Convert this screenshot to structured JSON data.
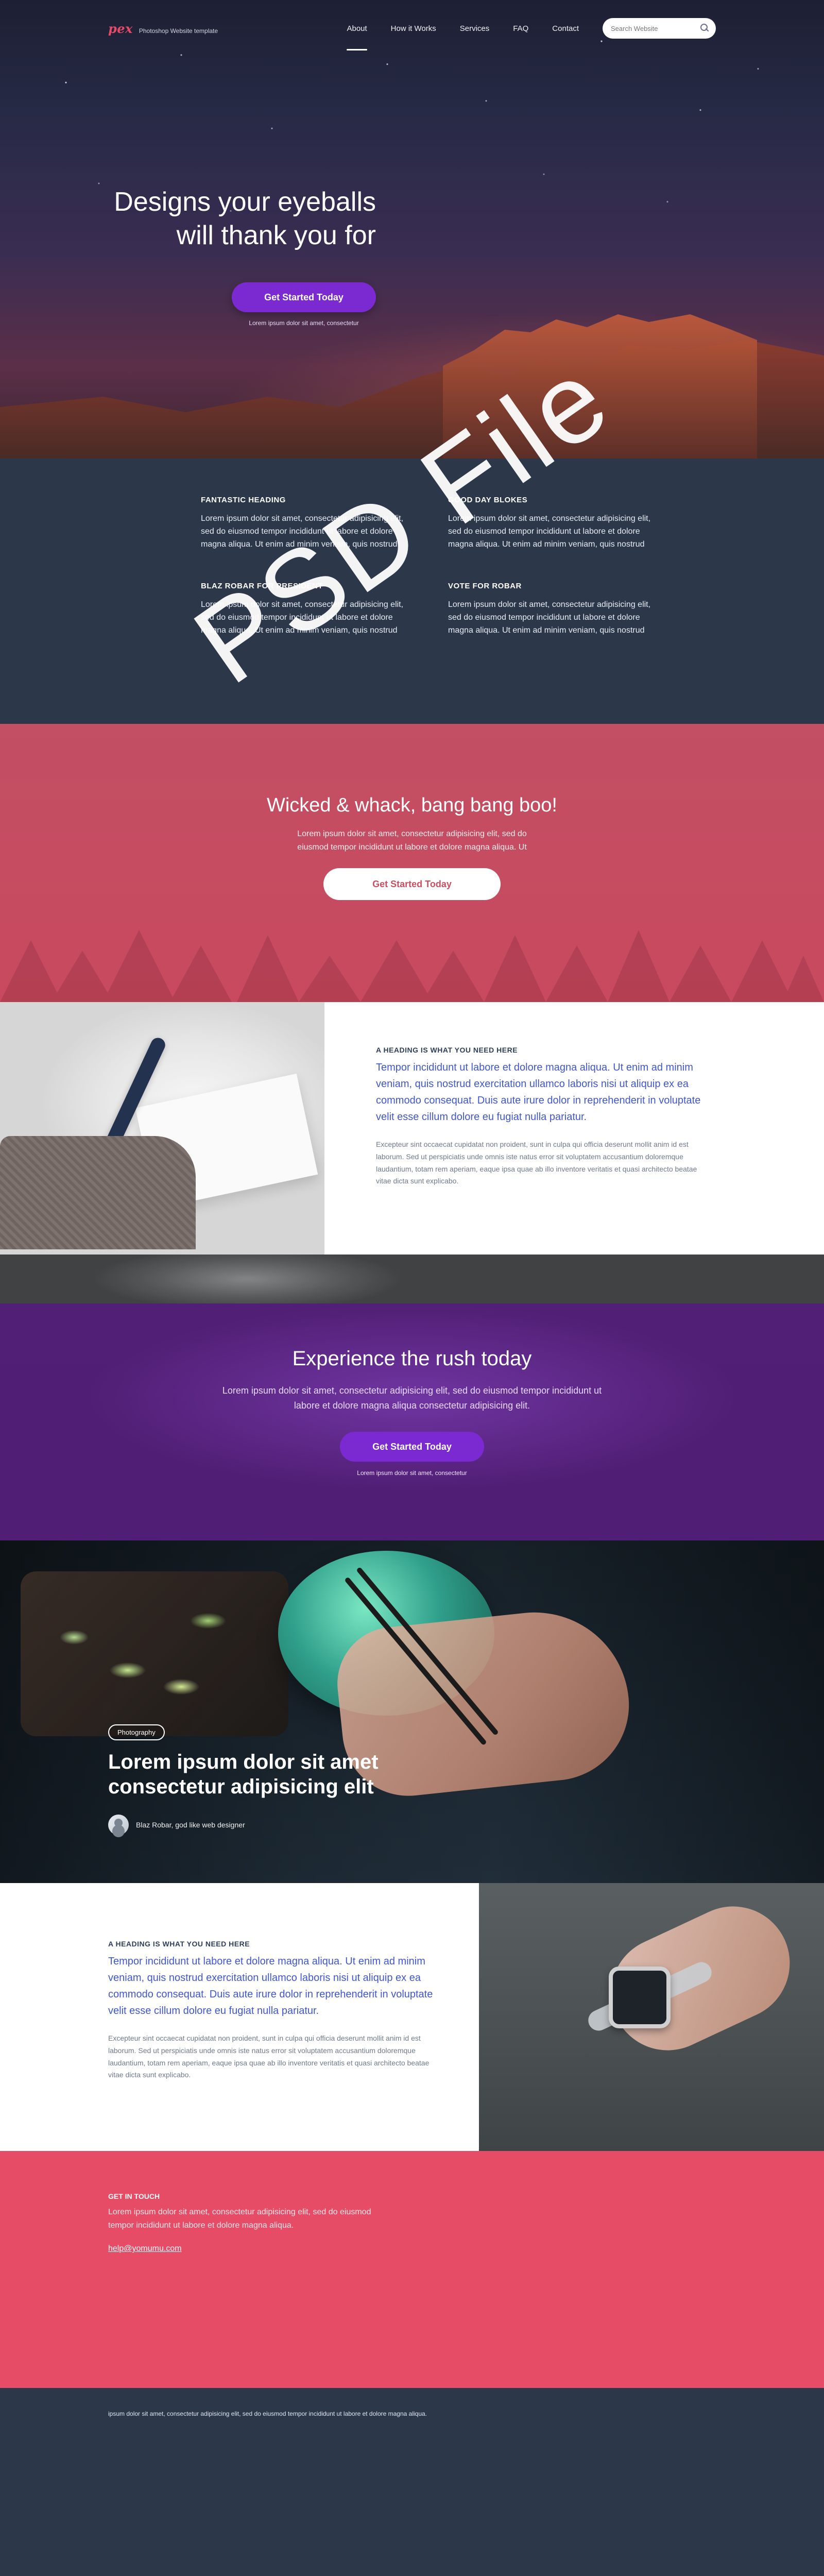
{
  "header": {
    "brand_logo": "pex",
    "brand_tagline": "Photoshop Website template",
    "nav": [
      {
        "label": "About",
        "active": true
      },
      {
        "label": "How it Works"
      },
      {
        "label": "Services"
      },
      {
        "label": "FAQ"
      },
      {
        "label": "Contact"
      }
    ],
    "search_placeholder": "Search Website"
  },
  "hero": {
    "title_line1": "Designs your eyeballs",
    "title_line2": "will thank you for",
    "cta_label": "Get Started Today",
    "subtext": "Lorem ipsum dolor sit amet, consectetur"
  },
  "watermark": "PSD File",
  "features": [
    {
      "title": "FANTASTIC HEADING",
      "text": "Lorem ipsum dolor sit amet, consectetur adipisicing elit, sed do eiusmod tempor incididunt ut labore et dolore magna aliqua. Ut enim ad minim veniam, quis nostrud"
    },
    {
      "title": "GOOD DAY BLOKES",
      "text": "Lorem ipsum dolor sit amet, consectetur adipisicing elit, sed do eiusmod tempor incididunt ut labore et dolore magna aliqua. Ut enim ad minim veniam, quis nostrud"
    },
    {
      "title": "BLAZ ROBAR FOR PRESIDENT",
      "text": "Lorem ipsum dolor sit amet, consectetur adipisicing elit, sed do eiusmod tempor incididunt ut labore et dolore magna aliqua. Ut enim ad minim veniam, quis nostrud"
    },
    {
      "title": "VOTE FOR ROBAR",
      "text": "Lorem ipsum dolor sit amet, consectetur adipisicing elit, sed do eiusmod tempor incididunt ut labore et dolore magna aliqua. Ut enim ad minim veniam, quis nostrud"
    }
  ],
  "pink_band": {
    "title": "Wicked & whack, bang bang boo!",
    "text": "Lorem ipsum dolor sit amet, consectetur adipisicing elit, sed do eiusmod tempor incididunt ut labore et dolore magna aliqua. Ut",
    "cta_label": "Get Started Today"
  },
  "section_text_1": {
    "eyebrow": "A HEADING IS WHAT YOU NEED HERE",
    "lead": "Tempor incididunt ut labore et dolore magna aliqua. Ut enim ad minim veniam, quis nostrud exercitation ullamco laboris nisi ut aliquip ex ea commodo consequat. Duis aute irure dolor in reprehenderit in voluptate velit esse cillum dolore eu fugiat nulla pariatur.",
    "muted": "Excepteur sint occaecat cupidatat non proident, sunt in culpa qui officia deserunt mollit anim id est laborum. Sed ut perspiciatis unde omnis iste natus error sit voluptatem accusantium doloremque laudantium, totam rem aperiam, eaque ipsa quae ab illo inventore veritatis et quasi architecto beatae vitae dicta sunt explicabo."
  },
  "purple_band": {
    "title": "Experience the rush today",
    "text": "Lorem ipsum dolor sit amet, consectetur adipisicing elit, sed do eiusmod tempor incididunt ut labore et dolore magna aliqua consectetur adipisicing elit.",
    "cta_label": "Get Started Today",
    "subtext": "Lorem ipsum dolor sit amet, consectetur"
  },
  "food_section": {
    "tag": "Photography",
    "title": "Lorem ipsum dolor sit amet consectetur adipisicing elit",
    "author": "Blaz Robar, god like web designer"
  },
  "section_text_2": {
    "eyebrow": "A HEADING IS WHAT YOU NEED HERE",
    "lead": "Tempor incididunt ut labore et dolore magna aliqua. Ut enim ad minim veniam, quis nostrud exercitation ullamco laboris nisi ut aliquip ex ea commodo consequat. Duis aute irure dolor in reprehenderit in voluptate velit esse cillum dolore eu fugiat nulla pariatur.",
    "muted": "Excepteur sint occaecat cupidatat non proident, sunt in culpa qui officia deserunt mollit anim id est laborum. Sed ut perspiciatis unde omnis iste natus error sit voluptatem accusantium doloremque laudantium, totam rem aperiam, eaque ipsa quae ab illo inventore veritatis et quasi architecto beatae vitae dicta sunt explicabo."
  },
  "contact": {
    "heading": "GET IN TOUCH",
    "text": "Lorem ipsum dolor sit amet, consectetur adipisicing elit, sed do eiusmod tempor incididunt ut labore et dolore magna aliqua.",
    "email": "help@yomumu.com"
  },
  "footer": {
    "text": "ipsum dolor sit amet, consectetur adipisicing elit, sed do eiusmod tempor incididunt ut labore et dolore magna aliqua."
  },
  "colors": {
    "brand": "#e44b69",
    "primary_purple": "#7b2ad1",
    "dark_navy": "#2c374a",
    "pink_band": "#c24f64",
    "contact_pink": "#e64c66",
    "lead_blue": "#3f56d1"
  }
}
